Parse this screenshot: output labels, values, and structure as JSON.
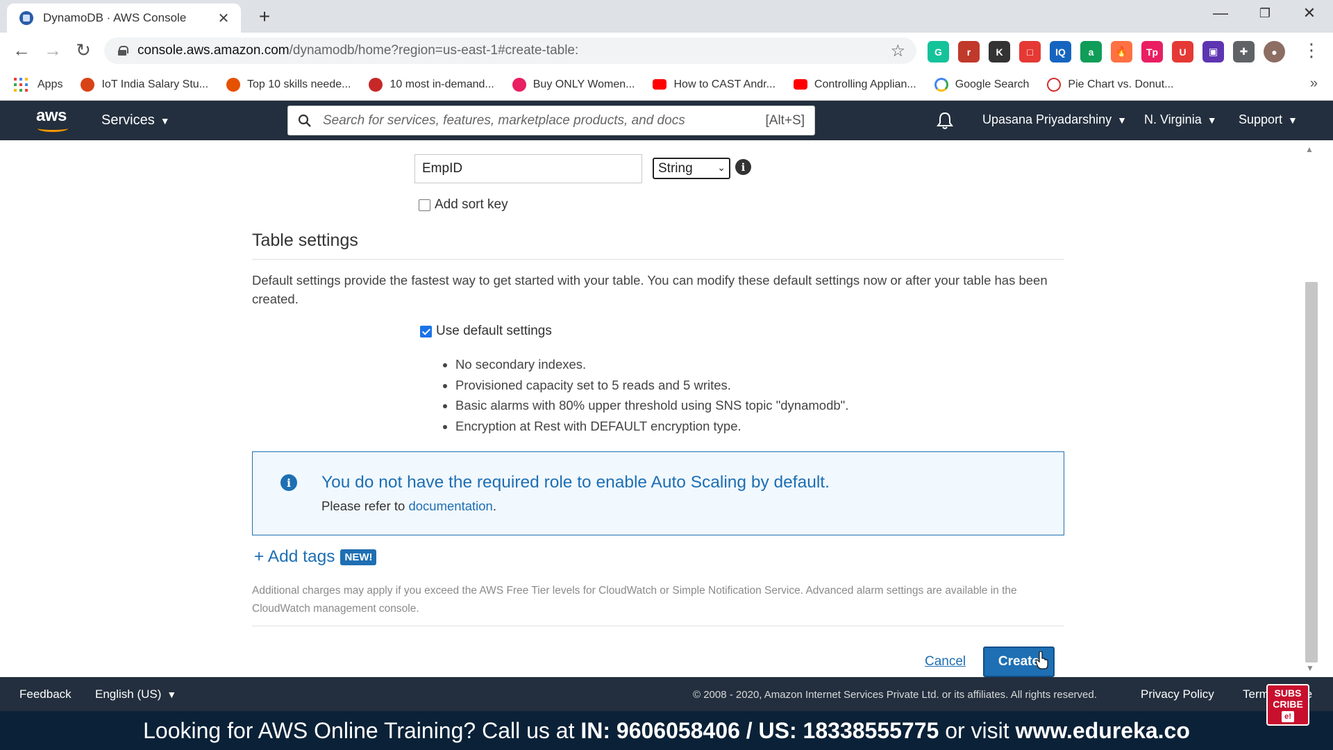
{
  "browser": {
    "tab_title": "DynamoDB · AWS Console",
    "url_host": "console.aws.amazon.com",
    "url_path": "/dynamodb/home?region=us-east-1#create-table:",
    "extensions": [
      {
        "name": "grammarly-icon",
        "color": "#15c39a",
        "label": "G"
      },
      {
        "name": "redir-icon",
        "color": "#c0392b",
        "label": "r"
      },
      {
        "name": "k-extension-icon",
        "color": "#333333",
        "label": "K"
      },
      {
        "name": "red-square-icon",
        "color": "#e53935",
        "label": "□"
      },
      {
        "name": "iq-icon",
        "color": "#1565c0",
        "label": "IQ"
      },
      {
        "name": "green-badge-icon",
        "color": "#0f9d58",
        "label": "a"
      },
      {
        "name": "fire-icon",
        "color": "#ff7043",
        "label": "🔥"
      },
      {
        "name": "tp-icon",
        "color": "#e91e63",
        "label": "Tp"
      },
      {
        "name": "u-icon",
        "color": "#e53935",
        "label": "U"
      },
      {
        "name": "purple-box-icon",
        "color": "#5e35b1",
        "label": "▣"
      },
      {
        "name": "puzzle-icon",
        "color": "#5f6368",
        "label": "✚"
      },
      {
        "name": "profile-avatar-icon",
        "color": "#8d6e63",
        "label": "●"
      }
    ]
  },
  "bookmarks": [
    {
      "label": "Apps",
      "icon": "apps-grid-icon"
    },
    {
      "label": "IoT India Salary Stu...",
      "icon": "bookmark-favicon",
      "color": "#d84315"
    },
    {
      "label": "Top 10 skills neede...",
      "icon": "bookmark-favicon",
      "color": "#e65100"
    },
    {
      "label": "10 most in-demand...",
      "icon": "bookmark-favicon",
      "color": "#c62828"
    },
    {
      "label": "Buy ONLY Women...",
      "icon": "myntra-icon",
      "color": "#e91e63"
    },
    {
      "label": "How to CAST Andr...",
      "icon": "youtube-icon",
      "color": "#ff0000"
    },
    {
      "label": "Controlling Applian...",
      "icon": "youtube-icon",
      "color": "#ff0000"
    },
    {
      "label": "Google Search",
      "icon": "google-icon",
      "color": "#4285f4"
    },
    {
      "label": "Pie Chart vs. Donut...",
      "icon": "circle-icon",
      "color": "#d32f2f"
    }
  ],
  "aws_header": {
    "logo": "aws",
    "services": "Services",
    "search_placeholder": "Search for services, features, marketplace products, and docs",
    "search_shortcut": "[Alt+S]",
    "user": "Upasana Priyadarshiny",
    "region": "N. Virginia",
    "support": "Support"
  },
  "form": {
    "partition_key_value": "EmpID",
    "key_type": "String",
    "add_sort_key_label": "Add sort key",
    "add_sort_key_checked": false,
    "table_settings_title": "Table settings",
    "table_settings_desc": "Default settings provide the fastest way to get started with your table. You can modify these default settings now or after your table has been created.",
    "use_default_label": "Use default settings",
    "use_default_checked": true,
    "defaults": [
      "No secondary indexes.",
      "Provisioned capacity set to 5 reads and 5 writes.",
      "Basic alarms with 80% upper threshold using SNS topic \"dynamodb\".",
      "Encryption at Rest with DEFAULT encryption type."
    ],
    "alert_title": "You do not have the required role to enable Auto Scaling by default.",
    "alert_prefix": "Please refer to",
    "alert_link": "documentation",
    "alert_suffix": ".",
    "add_tags_label": "+ Add tags",
    "new_badge": "NEW!",
    "charges_note": "Additional charges may apply if you exceed the AWS Free Tier levels for CloudWatch or Simple Notification Service. Advanced alarm settings are available in the CloudWatch management console.",
    "cancel_label": "Cancel",
    "create_label": "Create"
  },
  "footer": {
    "feedback": "Feedback",
    "language": "English (US)",
    "copyright": "© 2008 - 2020, Amazon Internet Services Private Ltd. or its affiliates. All rights reserved.",
    "privacy": "Privacy Policy",
    "terms": "Terms of Use"
  },
  "promo": {
    "prefix": "Looking for AWS Online Training? Call us at",
    "phones": "IN: 9606058406 / US: 18338555775",
    "mid": "or visit",
    "site": "www.edureka.co"
  },
  "subscribe_badge": {
    "line1": "SUBS",
    "line2": "CRIBE",
    "line3": "e!"
  }
}
